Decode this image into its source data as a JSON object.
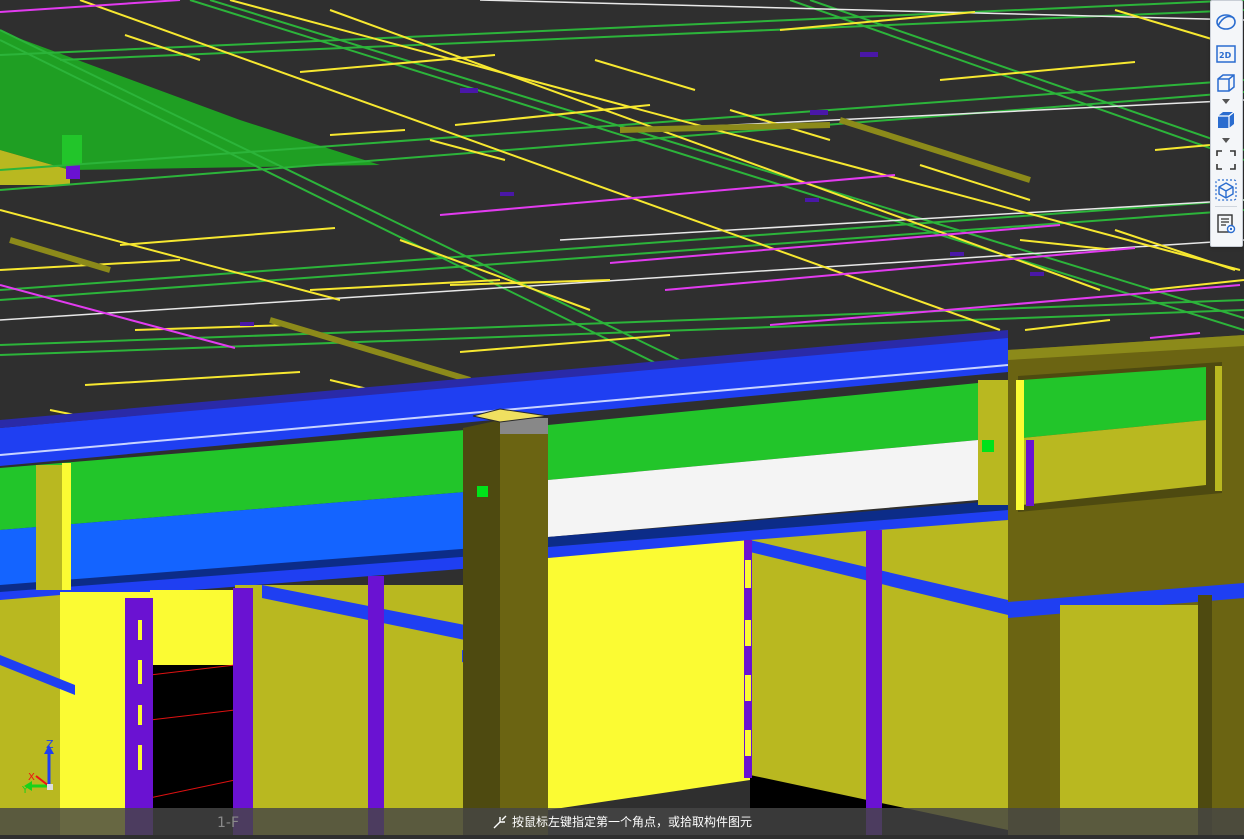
{
  "viewport": {
    "background": "#2f2f2f",
    "scene": "3D building model view",
    "colors": {
      "beam_blue": "#1f3ff2",
      "beam_blue_light": "#1464ff",
      "wall_yellow": "#b9b820",
      "wall_yellow_bright": "#fbfb33",
      "green": "#22c52a",
      "column_olive": "#6b6412",
      "rebar_purple": "#6a12d2",
      "line_yellow": "#f7e830",
      "line_magenta": "#e23bf0",
      "line_green": "#2cb43a"
    }
  },
  "floor_label": "1-F",
  "axis": {
    "z": "Z",
    "x": "X",
    "y": "Y"
  },
  "toolbar": {
    "items": [
      {
        "name": "dynamic-observe-icon",
        "label": ""
      },
      {
        "name": "view-2d-icon",
        "label": "2D"
      },
      {
        "name": "view-3d-icon",
        "label": ""
      },
      {
        "name": "display-mode-icon",
        "label": ""
      },
      {
        "name": "fullscreen-icon",
        "label": ""
      },
      {
        "name": "component-cube-icon",
        "label": ""
      },
      {
        "name": "properties-view-icon",
        "label": ""
      }
    ]
  },
  "status": {
    "icon": "select-corner-icon",
    "text": "按鼠标左键指定第一个角点，或拾取构件图元"
  }
}
